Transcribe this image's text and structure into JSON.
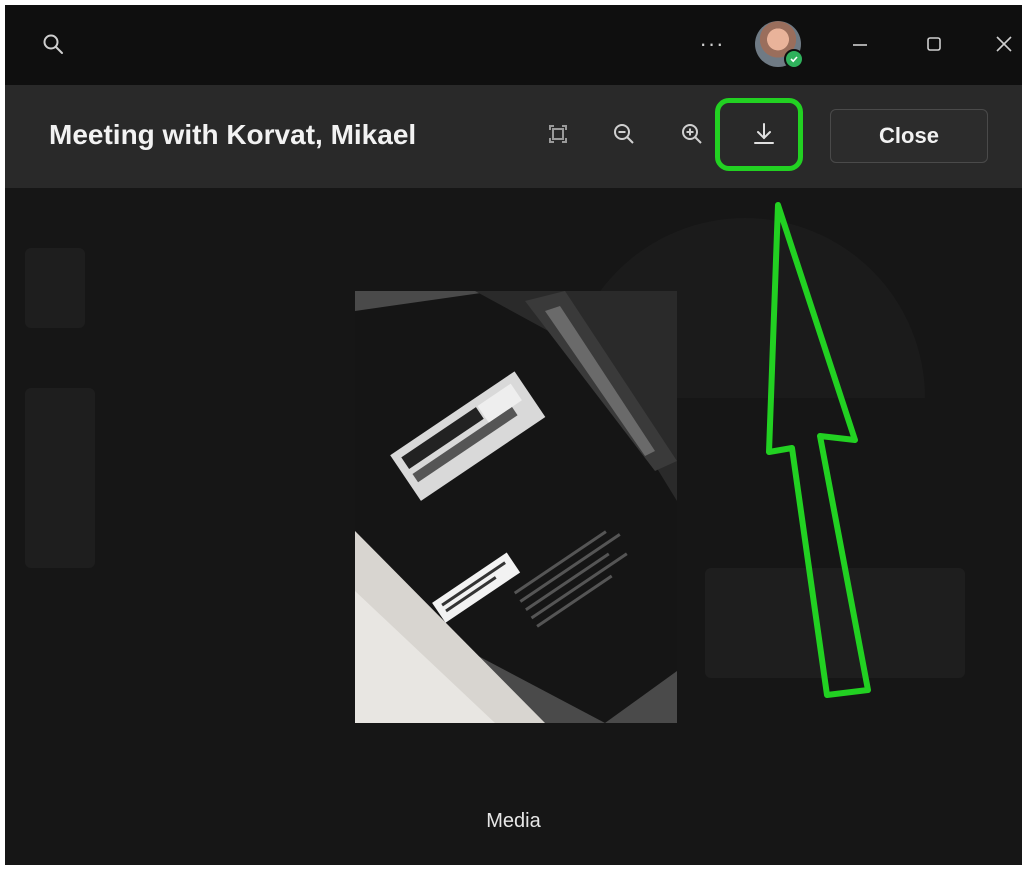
{
  "titlebar": {
    "search_icon": "search-icon",
    "more_label": "···",
    "avatar_icon": "user-avatar",
    "presence_status": "available",
    "minimize_icon": "minimize-icon",
    "maximize_icon": "maximize-icon",
    "close_icon": "close-icon"
  },
  "header": {
    "title": "Meeting with Korvat, Mikael",
    "tools": [
      {
        "name": "fit-to-screen-icon"
      },
      {
        "name": "zoom-out-icon"
      },
      {
        "name": "zoom-in-icon"
      },
      {
        "name": "download-icon"
      }
    ],
    "close_label": "Close"
  },
  "viewer": {
    "media_label": "Media",
    "photo_subject": "label on the back of a monitor"
  },
  "annotation": {
    "highlight_color": "#22d122"
  }
}
